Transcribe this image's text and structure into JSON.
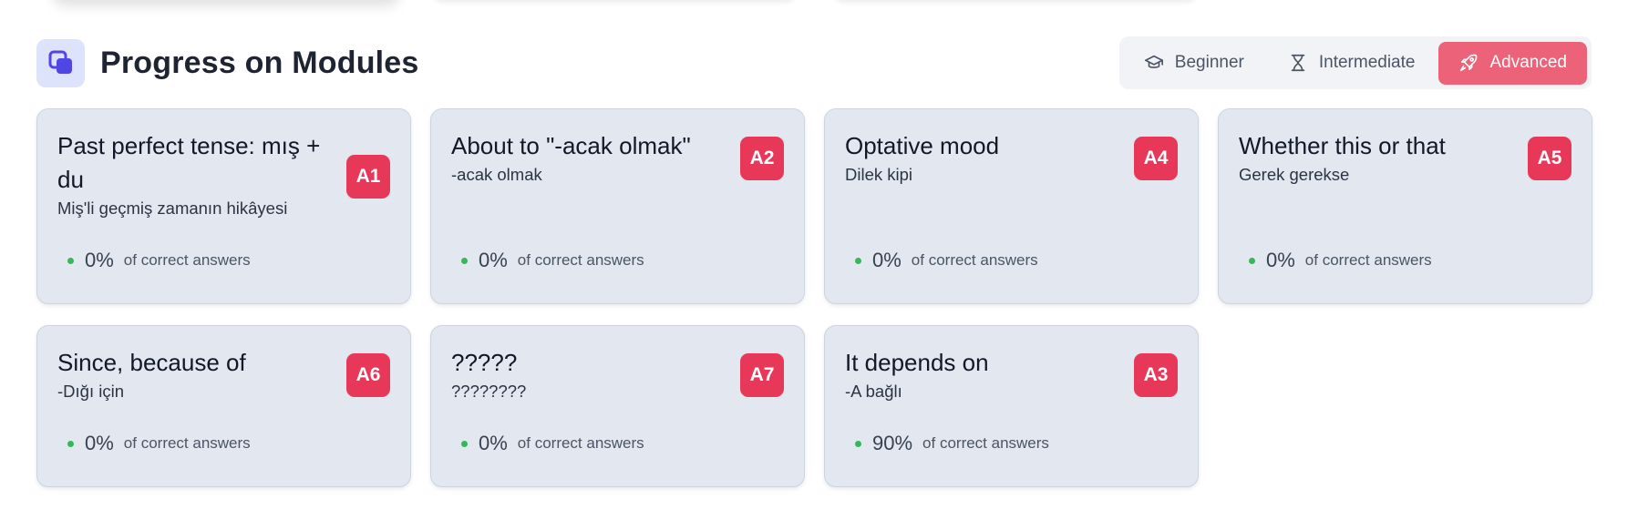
{
  "section": {
    "title": "Progress on Modules",
    "icon": "stacked-squares-icon",
    "accent_color": "#4f46e5"
  },
  "level_filter": {
    "selected": "Advanced",
    "options": [
      {
        "label": "Beginner",
        "icon": "graduation-cap-icon"
      },
      {
        "label": "Intermediate",
        "icon": "hourglass-icon"
      },
      {
        "label": "Advanced",
        "icon": "rocket-icon"
      }
    ],
    "active_color": "#ec6278"
  },
  "modules": [
    {
      "title": "Past perfect tense: mış + du",
      "subtitle": "Miş'li geçmiş zamanın hikâyesi",
      "level": "A1",
      "progress": "0%",
      "progress_label": "of correct answers"
    },
    {
      "title": "About to \"-acak olmak\"",
      "subtitle": "-acak olmak",
      "level": "A2",
      "progress": "0%",
      "progress_label": "of correct answers"
    },
    {
      "title": "Optative mood",
      "subtitle": "Dilek kipi",
      "level": "A4",
      "progress": "0%",
      "progress_label": "of correct answers"
    },
    {
      "title": "Whether this or that",
      "subtitle": "Gerek gerekse",
      "level": "A5",
      "progress": "0%",
      "progress_label": "of correct answers"
    },
    {
      "title": "Since, because of",
      "subtitle": "-Dığı için",
      "level": "A6",
      "progress": "0%",
      "progress_label": "of correct answers"
    },
    {
      "title": "?????",
      "subtitle": "????????",
      "level": "A7",
      "progress": "0%",
      "progress_label": "of correct answers"
    },
    {
      "title": "It depends on",
      "subtitle": "-A bağlı",
      "level": "A3",
      "progress": "90%",
      "progress_label": "of correct answers"
    }
  ],
  "colors": {
    "badge": "#e7385a",
    "status_dot": "#34b85a",
    "card_background": "#e2e7f0"
  }
}
